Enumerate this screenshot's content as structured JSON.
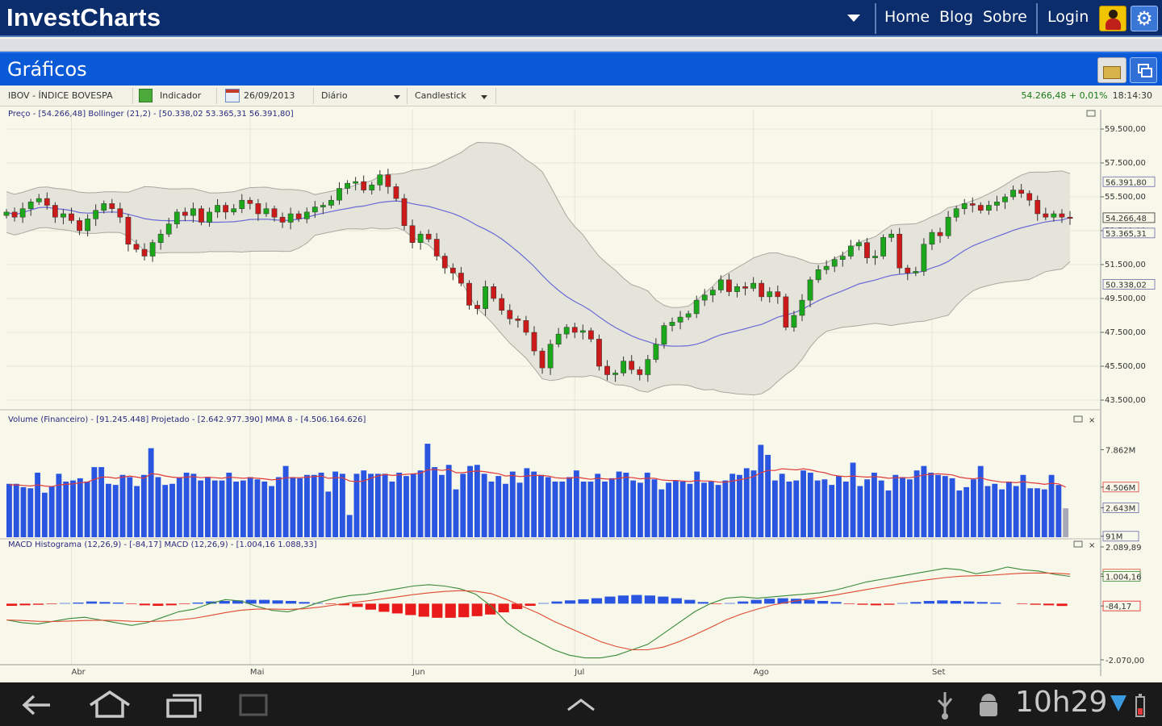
{
  "app": {
    "brand": "InvestCharts",
    "nav": [
      {
        "key": "home",
        "label": "Home"
      },
      {
        "key": "blog",
        "label": "Blog"
      },
      {
        "key": "sobre",
        "label": "Sobre"
      },
      {
        "key": "login",
        "label": "Login"
      }
    ]
  },
  "panel": {
    "title": "Gráficos"
  },
  "toolbar": {
    "symbol": "IBOV - ÍNDICE BOVESPA",
    "indicator_label": "Indicador",
    "date": "26/09/2013",
    "period": "Diário",
    "chart_type": "Candlestick",
    "last_price": "54.266,48",
    "change": "+ 0,01%",
    "time": "18:14:30"
  },
  "colors": {
    "up": "#1aa81a",
    "down": "#cc1a1a",
    "band_fill": "#e4e4da",
    "band_line": "#a8a8a0",
    "middle_line": "#6a6ad8",
    "volume": "#2a55e0",
    "volume_ma": "#e03a3a",
    "macd_line": "#3a8a3a",
    "signal_line": "#e04a30",
    "hist_pos": "#2a55e0",
    "hist_neg": "#e81a1a"
  },
  "chart_data": [
    {
      "type": "candlestick",
      "legend": "Preço - [54.266,48]   Bollinger (21,2) - [50.338,02  53.365,31  56.391,80]",
      "y_ticks": [
        "59.500,00",
        "57.500,00",
        "55.500,00",
        "53.500,00",
        "51.500,00",
        "49.500,00",
        "47.500,00",
        "45.500,00",
        "43.500,00"
      ],
      "y_tick_values": [
        59500,
        57500,
        55500,
        53500,
        51500,
        49500,
        47500,
        45500,
        43500
      ],
      "ylim": [
        43500,
        59500
      ],
      "value_tags": [
        "56.391,80",
        "54.266,48",
        "53.365,31",
        "50.338,02"
      ],
      "value_tag_values": [
        56391.8,
        54266.48,
        53365.31,
        50338.02
      ],
      "x_labels": [
        "Abr",
        "Mai",
        "Jun",
        "Jul",
        "Ago",
        "Set"
      ],
      "x_label_index": [
        8,
        30,
        50,
        70,
        92,
        114
      ],
      "closes": [
        54600,
        54300,
        54800,
        55200,
        55400,
        55000,
        54300,
        54500,
        54100,
        53500,
        54200,
        54700,
        55100,
        54800,
        54300,
        52700,
        52400,
        52000,
        52800,
        53300,
        53900,
        54600,
        54400,
        54800,
        54000,
        54600,
        55000,
        54600,
        54800,
        55300,
        55100,
        54500,
        54800,
        54300,
        54000,
        54500,
        54200,
        54600,
        54900,
        55000,
        55300,
        56000,
        56300,
        56400,
        55900,
        56200,
        56800,
        56100,
        55400,
        53800,
        52800,
        53300,
        53000,
        52000,
        51300,
        51000,
        50400,
        49100,
        48900,
        50200,
        49500,
        48800,
        48300,
        48200,
        47500,
        46400,
        45400,
        46800,
        47400,
        47800,
        47500,
        47600,
        47100,
        45500,
        45000,
        45100,
        45800,
        45300,
        45000,
        45900,
        46800,
        47900,
        48100,
        48400,
        48600,
        49400,
        49700,
        50000,
        50600,
        49900,
        50200,
        50100,
        50400,
        49600,
        49900,
        49600,
        47800,
        48500,
        49400,
        50600,
        51200,
        51400,
        51800,
        52000,
        52600,
        52800,
        51900,
        52000,
        53100,
        53300,
        51300,
        51000,
        51100,
        52700,
        53400,
        53200,
        54300,
        54800,
        55100,
        55000,
        54700,
        55000,
        55200,
        55500,
        55900,
        55700,
        55300,
        54500,
        54300,
        54500,
        54300,
        54266
      ]
    },
    {
      "type": "bar",
      "legend": "Volume (Financeiro) - [91.245.448]   Projetado - [2.642.977.390]   MMA 8 - [4.506.164.626]",
      "y_ticks": [
        "7.862M",
        "4.506M",
        "2.643M",
        "91M"
      ],
      "y_tick_values": [
        7862,
        4506,
        2643,
        91
      ],
      "ylim": [
        0,
        10000
      ],
      "values": [
        4800,
        4800,
        4500,
        4400,
        5800,
        4000,
        4600,
        5700,
        5000,
        5100,
        5300,
        5000,
        6300,
        6300,
        4800,
        4700,
        5600,
        5400,
        4600,
        5600,
        8000,
        5400,
        4700,
        4800,
        5400,
        5800,
        5700,
        5100,
        5400,
        5100,
        5100,
        5800,
        5000,
        5100,
        5400,
        5200,
        5000,
        4600,
        5400,
        6400,
        5400,
        5300,
        5600,
        5600,
        5800,
        4100,
        5900,
        5700,
        2000,
        5700,
        6000,
        5700,
        5700,
        5700,
        5000,
        5800,
        5500,
        5700,
        6000,
        8400,
        6300,
        5600,
        6500,
        4300,
        5700,
        6400,
        6500,
        5700,
        5000,
        5500,
        4800,
        5900,
        4900,
        6200,
        5900,
        5600,
        5400,
        5000,
        5000,
        5400,
        6000,
        5000,
        5000,
        5700,
        5000,
        5300,
        5900,
        5800,
        5100,
        4900,
        5800,
        5200,
        4300,
        4900,
        5100,
        5000,
        4800,
        5900,
        4900,
        5000,
        4700,
        5100,
        5700,
        5600,
        6200,
        6000,
        8300,
        7400,
        5100,
        5700,
        5000,
        5100,
        6000,
        5800,
        5100,
        5200,
        4700,
        5500,
        5000,
        6700,
        4600,
        5200,
        5800,
        5100,
        4200,
        5600,
        5400,
        5200,
        6000,
        6400,
        5800,
        5600,
        5500,
        5300,
        4200,
        4500,
        5200,
        6400,
        4600,
        4800,
        4300,
        5000,
        4600,
        5600,
        4400,
        4400,
        4300,
        5600,
        4700,
        2600
      ],
      "ma": [
        4700,
        4700,
        4650,
        4600,
        4700,
        4600,
        4550,
        4700,
        4750,
        4800,
        4900,
        4950,
        5200,
        5400,
        5400,
        5300,
        5400,
        5500,
        5400,
        5300,
        5700,
        5650,
        5500,
        5400,
        5350,
        5400,
        5450,
        5350,
        5400,
        5350,
        5300,
        5400,
        5350,
        5300,
        5350,
        5300,
        5250,
        5150,
        5200,
        5350,
        5350,
        5350,
        5400,
        5450,
        5500,
        5300,
        5350,
        5350,
        5050,
        5000,
        5050,
        5300,
        5500,
        5650,
        5550,
        5600,
        5650,
        5700,
        5750,
        6050,
        6100,
        6000,
        6100,
        5800,
        5800,
        5900,
        5950,
        5900,
        5800,
        5700,
        5500,
        5550,
        5450,
        5500,
        5550,
        5550,
        5500,
        5350,
        5300,
        5300,
        5400,
        5300,
        5200,
        5300,
        5250,
        5200,
        5300,
        5400,
        5350,
        5250,
        5300,
        5300,
        5150,
        5100,
        5100,
        5050,
        5000,
        5100,
        5050,
        5050,
        4950,
        4950,
        5050,
        5150,
        5300,
        5450,
        5800,
        6000,
        6000,
        6150,
        6100,
        6050,
        6150,
        6050,
        5900,
        5800,
        5600,
        5500,
        5450,
        5500,
        5450,
        5400,
        5450,
        5400,
        5300,
        5350,
        5350,
        5350,
        5450,
        5600,
        5650,
        5700,
        5650,
        5600,
        5400,
        5300,
        5250,
        5350,
        5150,
        5050,
        4950,
        4950,
        4900,
        5000,
        4900,
        4850,
        4750,
        4850,
        4800,
        4500
      ]
    },
    {
      "type": "line",
      "legend": "MACD Histograma (12,26,9) - [-84,17]   MACD (12,26,9) - [1.004,16  1.088,33]",
      "y_ticks": [
        "2.089,89",
        "1.088,33",
        "1.004,16",
        "-84,17",
        "-2.070,00"
      ],
      "y_tick_values": [
        2089.89,
        1088.33,
        1004.16,
        -84.17,
        -2070
      ],
      "ylim": [
        -2070,
        2089.89
      ],
      "series": [
        {
          "name": "MACD",
          "values": [
            -600,
            -700,
            -750,
            -650,
            -550,
            -500,
            -600,
            -700,
            -800,
            -700,
            -500,
            -300,
            -200,
            0,
            150,
            100,
            -100,
            -250,
            -300,
            -150,
            50,
            200,
            300,
            350,
            450,
            550,
            650,
            700,
            650,
            550,
            350,
            -100,
            -700,
            -1100,
            -1400,
            -1700,
            -1900,
            -2000,
            -2000,
            -1900,
            -1700,
            -1500,
            -1100,
            -700,
            -300,
            0,
            200,
            250,
            200,
            250,
            300,
            350,
            400,
            500,
            650,
            800,
            900,
            1000,
            1100,
            1200,
            1300,
            1250,
            1100,
            1200,
            1350,
            1250,
            1200,
            1080,
            1004
          ]
        },
        {
          "name": "Sinal",
          "values": [
            -600,
            -620,
            -650,
            -660,
            -640,
            -620,
            -610,
            -620,
            -650,
            -660,
            -640,
            -600,
            -540,
            -440,
            -330,
            -240,
            -200,
            -200,
            -210,
            -190,
            -130,
            -50,
            30,
            100,
            170,
            250,
            330,
            400,
            450,
            480,
            460,
            370,
            150,
            -100,
            -350,
            -650,
            -900,
            -1150,
            -1400,
            -1580,
            -1700,
            -1700,
            -1600,
            -1400,
            -1150,
            -880,
            -600,
            -380,
            -200,
            -50,
            60,
            150,
            230,
            320,
            420,
            520,
            620,
            720,
            810,
            890,
            960,
            1010,
            1030,
            1050,
            1090,
            1120,
            1130,
            1120,
            1088
          ]
        }
      ],
      "histogram": [
        -80,
        -60,
        -40,
        -20,
        20,
        40,
        80,
        60,
        40,
        -20,
        -60,
        -80,
        -60,
        -20,
        40,
        80,
        100,
        120,
        140,
        140,
        120,
        100,
        60,
        20,
        -20,
        -60,
        -120,
        -220,
        -300,
        -360,
        -420,
        -480,
        -520,
        -520,
        -500,
        -460,
        -400,
        -320,
        -200,
        -80,
        20,
        80,
        120,
        160,
        200,
        260,
        300,
        320,
        300,
        260,
        200,
        140,
        60,
        -20,
        20,
        80,
        140,
        180,
        200,
        180,
        140,
        100,
        60,
        -20,
        -40,
        -60,
        -40,
        20,
        60,
        100,
        120,
        100,
        80,
        60,
        40,
        0,
        -20,
        -40,
        -60,
        -84
      ]
    }
  ],
  "system": {
    "clock": "10h29"
  }
}
